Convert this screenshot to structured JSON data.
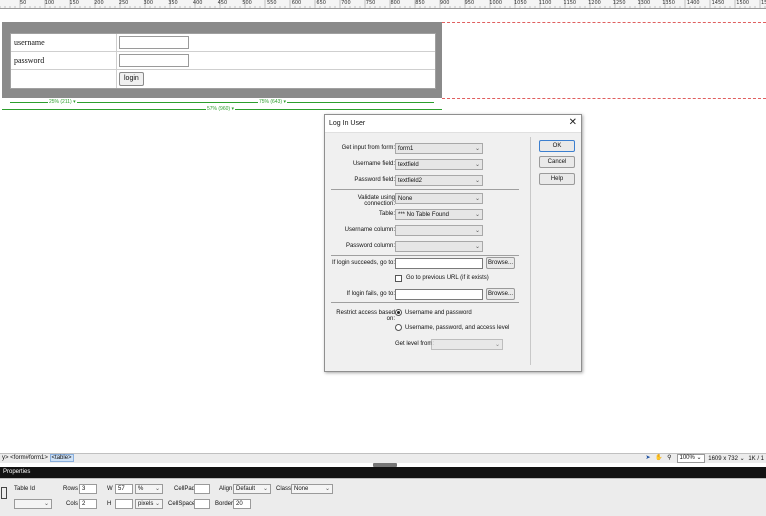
{
  "ruler": {
    "labels": [
      "50",
      "100",
      "150",
      "200",
      "250",
      "300",
      "350",
      "400",
      "450",
      "500",
      "550",
      "600",
      "650",
      "700",
      "750",
      "800",
      "850",
      "900",
      "950",
      "1000",
      "1050",
      "1100",
      "1150",
      "1200",
      "1250",
      "1300",
      "1350",
      "1400",
      "1450",
      "1500",
      "1550"
    ]
  },
  "form": {
    "username_label": "username",
    "password_label": "password",
    "login_button": "login"
  },
  "guides": {
    "left_label": "25% (211) ▾",
    "right_label": "75% (643) ▾",
    "total_label": "57% (960) ▾"
  },
  "dialog": {
    "title": "Log In User",
    "close_glyph": "✕",
    "get_input_label": "Get input from form:",
    "get_input_value": "form1",
    "username_field_label": "Username field:",
    "username_field_value": "textfield",
    "password_field_label": "Password field:",
    "password_field_value": "textfield2",
    "validate_label": "Validate using connection:",
    "validate_value": "None",
    "table_label": "Table:",
    "table_value": "*** No Table Found",
    "username_column_label": "Username column:",
    "username_column_value": "",
    "password_column_label": "Password column:",
    "password_column_value": "",
    "succeeds_label": "If login succeeds, go to:",
    "succeeds_value": "",
    "browse_label": "Browse...",
    "previous_url_label": "Go to previous URL (if it exists)",
    "previous_url_checked": false,
    "fails_label": "If login fails, go to:",
    "fails_value": "",
    "restrict_label": "Restrict access based on:",
    "radio_user_pass": "Username and password",
    "radio_user_pass_level": "Username, password, and access level",
    "radio_selected": "user_pass",
    "get_level_label": "Get level from:",
    "get_level_value": "",
    "ok_button": "OK",
    "cancel_button": "Cancel",
    "help_button": "Help"
  },
  "statusbar": {
    "tag_prefix": "y> <form#form1>",
    "tag_selected": "<table>",
    "zoom": "100%",
    "window_size": "1609 x 732",
    "file_info": "1K / 1"
  },
  "properties": {
    "title": "Properties",
    "table_id_label": "Table Id",
    "table_id_value": "",
    "rows_label": "Rows",
    "rows_value": "3",
    "cols_label": "Cols",
    "cols_value": "2",
    "w_label": "W",
    "w_value": "57",
    "w_unit": "%",
    "h_label": "H",
    "h_value": "",
    "h_unit": "pixels",
    "cellpad_label": "CellPad",
    "cellpad_value": "",
    "cellspace_label": "CellSpace",
    "cellspace_value": "",
    "align_label": "Align",
    "align_value": "Default",
    "border_label": "Border",
    "border_value": "20",
    "class_label": "Class",
    "class_value": "None"
  },
  "colors": {
    "frame_gray": "#8a8a8a",
    "guide_green": "#2c9e2c",
    "dashed_red": "#e06060",
    "panel_dark": "#121212",
    "ok_border": "#3c7fcf"
  }
}
